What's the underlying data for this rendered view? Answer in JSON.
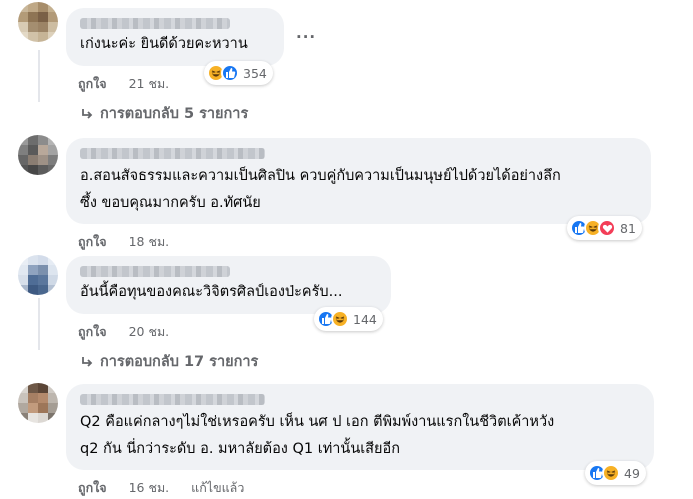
{
  "comments": [
    {
      "text_lines": [
        "เก่งนะค่ะ ยินดีด้วยคะหวาน"
      ],
      "actions": {
        "like": "ถูกใจ",
        "time": "21 ชม."
      },
      "reactions": {
        "icons": [
          "haha",
          "like"
        ],
        "count": "354"
      },
      "more_options": "···",
      "replies": "การตอบกลับ 5 รายการ"
    },
    {
      "text_lines": [
        "อ.สอนสัจธรรมและความเป็นศิลปิน ควบคู่กับความเป็นมนุษย์ไปด้วยได้อย่างลึก",
        "ซึ้ง ขอบคุณมากครับ อ.ทัศนัย"
      ],
      "actions": {
        "like": "ถูกใจ",
        "time": "18 ชม."
      },
      "reactions": {
        "icons": [
          "like",
          "haha",
          "love"
        ],
        "count": "81"
      }
    },
    {
      "text_lines": [
        "อันนี้คือทุนของคณะวิจิตรศิลป์เองป่ะครับ..."
      ],
      "actions": {
        "like": "ถูกใจ",
        "time": "20 ชม."
      },
      "reactions": {
        "icons": [
          "like",
          "haha"
        ],
        "count": "144"
      },
      "replies": "การตอบกลับ 17 รายการ"
    },
    {
      "text_lines": [
        "Q2 คือแค่กลางๆไม่ใช่เหรอครับ เห็น นศ ป เอก ตีพิมพ์งานแรกในชีวิตเค้าหวัง",
        "q2 กัน นี่กว่าระดับ อ. มหาลัยต้อง Q1 เท่านั้นเสียอีก"
      ],
      "actions": {
        "like": "ถูกใจ",
        "time": "16 ชม.",
        "edited": "แก้ไขแล้ว"
      },
      "reactions": {
        "icons": [
          "like",
          "haha"
        ],
        "count": "49"
      }
    }
  ],
  "colors": {
    "bubble": "#f0f2f5",
    "meta": "#65676b",
    "like": "#1877f2",
    "haha": "#f7b125",
    "love": "#f33e58"
  }
}
